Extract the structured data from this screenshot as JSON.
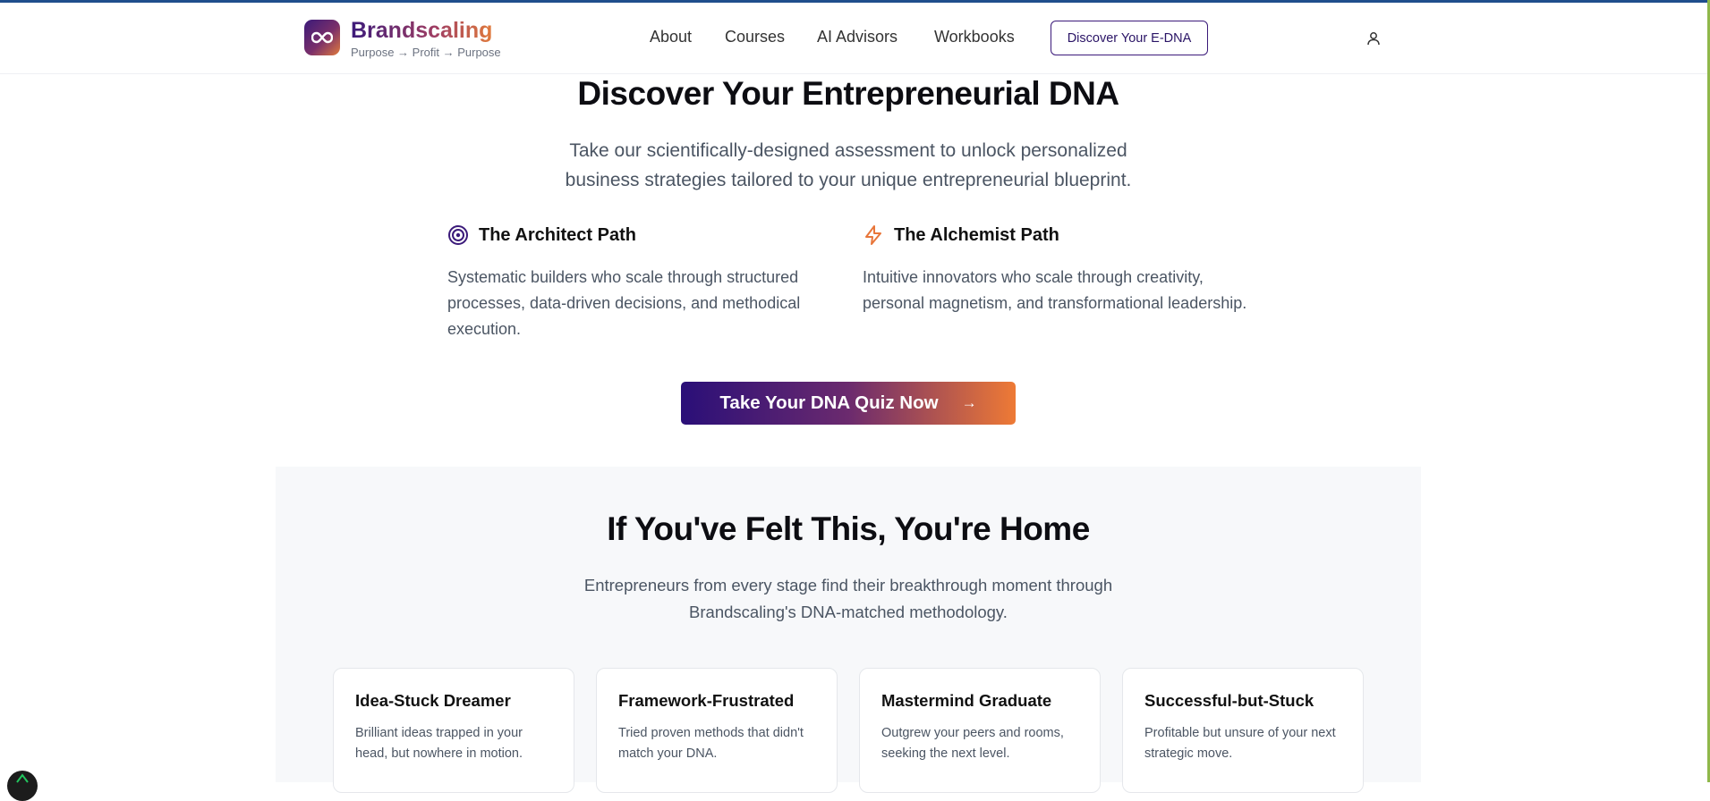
{
  "colors": {
    "brand_purple": "#3b1a7a",
    "brand_orange": "#e07a3c",
    "architect_icon": "#3b1a7a",
    "alchemist_icon": "#e8763a"
  },
  "header": {
    "brand_name": "Brandscaling",
    "tagline": "Purpose → Profit → Purpose",
    "logo_icon": "infinity-icon",
    "nav": [
      "About",
      "Courses",
      "AI Advisors",
      "Workbooks"
    ],
    "cta_label": "Discover Your E-DNA",
    "user_icon": "user-icon"
  },
  "hero": {
    "title": "Discover Your Entrepreneurial DNA",
    "subtitle": "Take our scientifically-designed assessment to unlock personalized business strategies tailored to your unique entrepreneurial blueprint.",
    "paths": [
      {
        "icon": "target-icon",
        "title": "The Architect Path",
        "description": "Systematic builders who scale through structured processes, data-driven decisions, and methodical execution."
      },
      {
        "icon": "lightning-icon",
        "title": "The Alchemist Path",
        "description": "Intuitive innovators who scale through creativity, personal magnetism, and transformational leadership."
      }
    ],
    "cta_label": "Take Your DNA Quiz Now",
    "cta_arrow": "→"
  },
  "home_section": {
    "title": "If You've Felt This, You're Home",
    "subtitle": "Entrepreneurs from every stage find their breakthrough moment through Brandscaling's DNA-matched methodology.",
    "cards": [
      {
        "title": "Idea-Stuck Dreamer",
        "description": "Brilliant ideas trapped in your head, but nowhere in motion."
      },
      {
        "title": "Framework-Frustrated",
        "description": "Tried proven methods that didn't match your DNA."
      },
      {
        "title": "Mastermind Graduate",
        "description": "Outgrew your peers and rooms, seeking the next level."
      },
      {
        "title": "Successful-but-Stuck",
        "description": "Profitable but unsure of your next strategic move."
      }
    ]
  }
}
